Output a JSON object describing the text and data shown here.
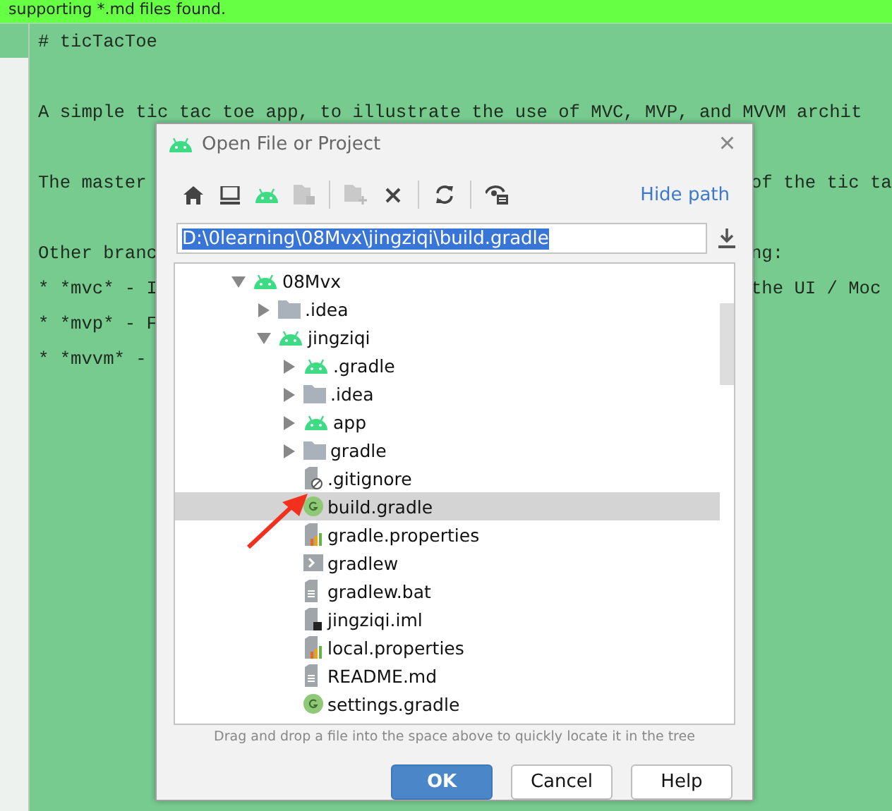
{
  "banner": {
    "text": "supporting *.md files found."
  },
  "editor": {
    "lines": [
      {
        "kind": "text",
        "left": "# ticTacToe"
      },
      {
        "kind": "blank"
      },
      {
        "kind": "text",
        "left": "A simple tic tac toe app, to illustrate the use of MVC, MVP, and MVVM archit"
      },
      {
        "kind": "blank"
      },
      {
        "kind": "text",
        "left": "The master",
        "right": "of the tic ta"
      },
      {
        "kind": "blank"
      },
      {
        "kind": "text",
        "left": "Other branc",
        "right": "ng:"
      },
      {
        "kind": "text",
        "left": "* *mvc* - I",
        "right": "the UI / Moc"
      },
      {
        "kind": "text",
        "left": "* *mvp* - F"
      },
      {
        "kind": "text",
        "left": "* *mvvm* -"
      }
    ]
  },
  "dialog": {
    "title": "Open File or Project",
    "close": "×",
    "toolbar": [
      {
        "kind": "home",
        "disabled": false
      },
      {
        "kind": "desktop",
        "disabled": false
      },
      {
        "kind": "project",
        "disabled": false
      },
      {
        "kind": "module",
        "disabled": true
      },
      {
        "kind": "separator"
      },
      {
        "kind": "new-folder",
        "disabled": true
      },
      {
        "kind": "delete",
        "disabled": false
      },
      {
        "kind": "separator"
      },
      {
        "kind": "refresh",
        "disabled": false
      },
      {
        "kind": "separator"
      },
      {
        "kind": "hidden",
        "disabled": false
      }
    ],
    "hide_path": "Hide path",
    "path": {
      "value": "D:\\0learning\\08Mvx\\jingziqi\\build.gradle",
      "selected": true
    },
    "tree": [
      {
        "label": "08Mvx",
        "kind": "android-folder",
        "expanded": true,
        "selected": false,
        "children": [
          {
            "label": ".idea",
            "kind": "folder",
            "expanded": false,
            "selected": false
          },
          {
            "label": "jingziqi",
            "kind": "android-folder",
            "expanded": true,
            "selected": false,
            "children": [
              {
                "label": ".gradle",
                "kind": "android-folder",
                "expanded": false,
                "selected": false
              },
              {
                "label": ".idea",
                "kind": "folder",
                "expanded": false,
                "selected": false
              },
              {
                "label": "app",
                "kind": "android-folder",
                "expanded": false,
                "selected": false
              },
              {
                "label": "gradle",
                "kind": "folder",
                "expanded": false,
                "selected": false
              },
              {
                "label": ".gitignore",
                "kind": "ignore-file",
                "selected": false
              },
              {
                "label": "build.gradle",
                "kind": "gradle-file",
                "selected": true
              },
              {
                "label": "gradle.properties",
                "kind": "properties-file",
                "selected": false
              },
              {
                "label": "gradlew",
                "kind": "script-file",
                "selected": false
              },
              {
                "label": "gradlew.bat",
                "kind": "text-file",
                "selected": false
              },
              {
                "label": "jingziqi.iml",
                "kind": "module-file",
                "selected": false
              },
              {
                "label": "local.properties",
                "kind": "properties-file",
                "selected": false
              },
              {
                "label": "README.md",
                "kind": "text-file",
                "selected": false
              },
              {
                "label": "settings.gradle",
                "kind": "gradle-file",
                "selected": false
              }
            ]
          }
        ]
      }
    ],
    "hint": "Drag and drop a file into the space above to quickly locate it in the tree",
    "buttons": [
      {
        "label": "OK",
        "default": true
      },
      {
        "label": "Cancel",
        "default": false
      },
      {
        "label": "Help",
        "default": false
      }
    ]
  }
}
